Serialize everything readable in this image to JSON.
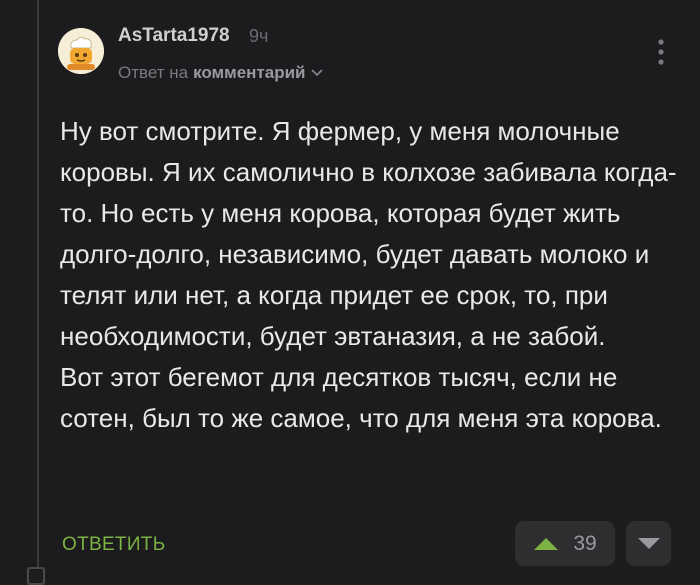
{
  "comment": {
    "author": "AsTarta1978",
    "time": "9ч",
    "reply_prefix": "Ответ на",
    "reply_target": "комментарий",
    "paragraphs": [
      "Ну вот смотрите. Я фермер, у меня молочные коровы. Я их самолично в колхозе забивала когда-то. Но есть у меня корова, которая будет жить долго-долго, независимо, будет давать молоко и телят или нет, а когда придет ее срок, то, при необходимости, будет эвтаназия, а не забой.",
      "Вот этот бегемот для десятков тысяч, если не сотен, был то же самое, что для меня эта корова."
    ],
    "reply_button": "ОТВЕТИТЬ",
    "rating": "39"
  },
  "icons": {
    "avatar": "cartoon-avatar",
    "menu": "more-vertical-icon",
    "reply_chevron": "chevron-down-icon",
    "upvote": "arrow-up-triangle-icon",
    "downvote": "arrow-down-triangle-icon"
  },
  "colors": {
    "background": "#1c1c1e",
    "accent_green": "#7cb342",
    "button_bg": "#2e2e31"
  }
}
